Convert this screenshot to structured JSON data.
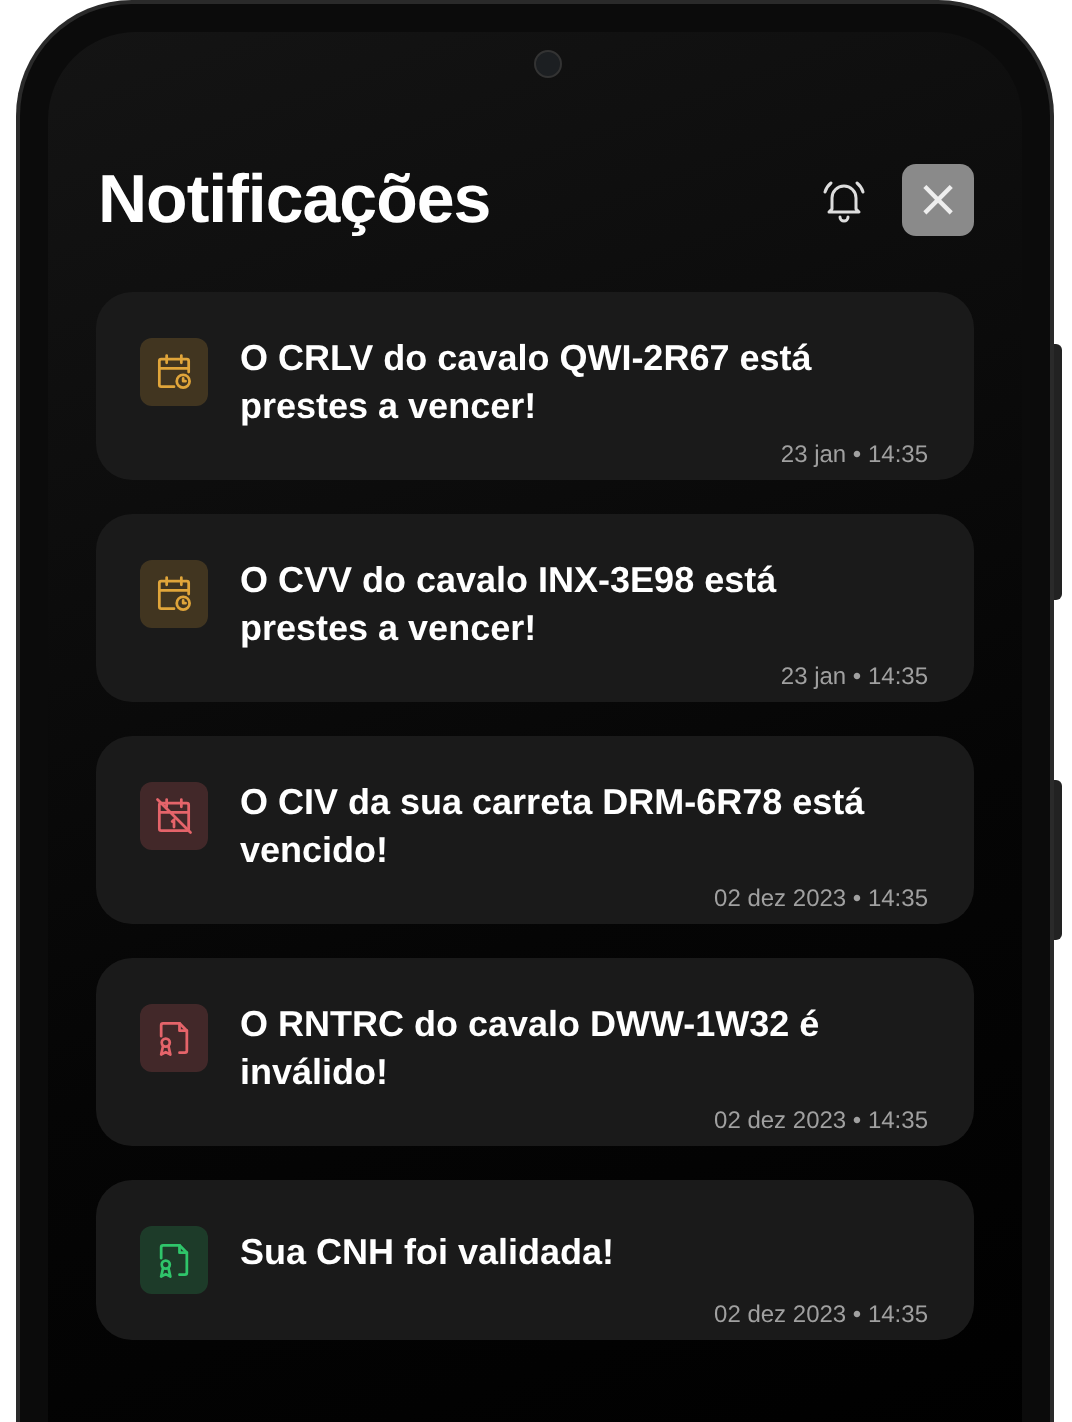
{
  "header": {
    "title": "Notificações",
    "close_icon": "×"
  },
  "notifications": [
    {
      "kind": "calendar-clock",
      "color": "#e0a53a",
      "message": "O CRLV do cavalo QWI-2R67 está prestes a vencer!",
      "time": "23 jan • 14:35"
    },
    {
      "kind": "calendar-clock",
      "color": "#e0a53a",
      "message": "O CVV do cavalo INX-3E98 está prestes a vencer!",
      "time": "23 jan • 14:35"
    },
    {
      "kind": "calendar-off",
      "color": "#e5646a",
      "message": "O CIV da sua carreta DRM-6R78 está vencido!",
      "time": "02 dez 2023 • 14:35"
    },
    {
      "kind": "certificate",
      "color": "#e5646a",
      "message": "O RNTRC do cavalo DWW-1W32 é inválido!",
      "time": "02 dez 2023 • 14:35"
    },
    {
      "kind": "certificate",
      "color": "#2fc56a",
      "message": "Sua CNH foi validada!",
      "time": "02 dez 2023 • 14:35"
    }
  ]
}
